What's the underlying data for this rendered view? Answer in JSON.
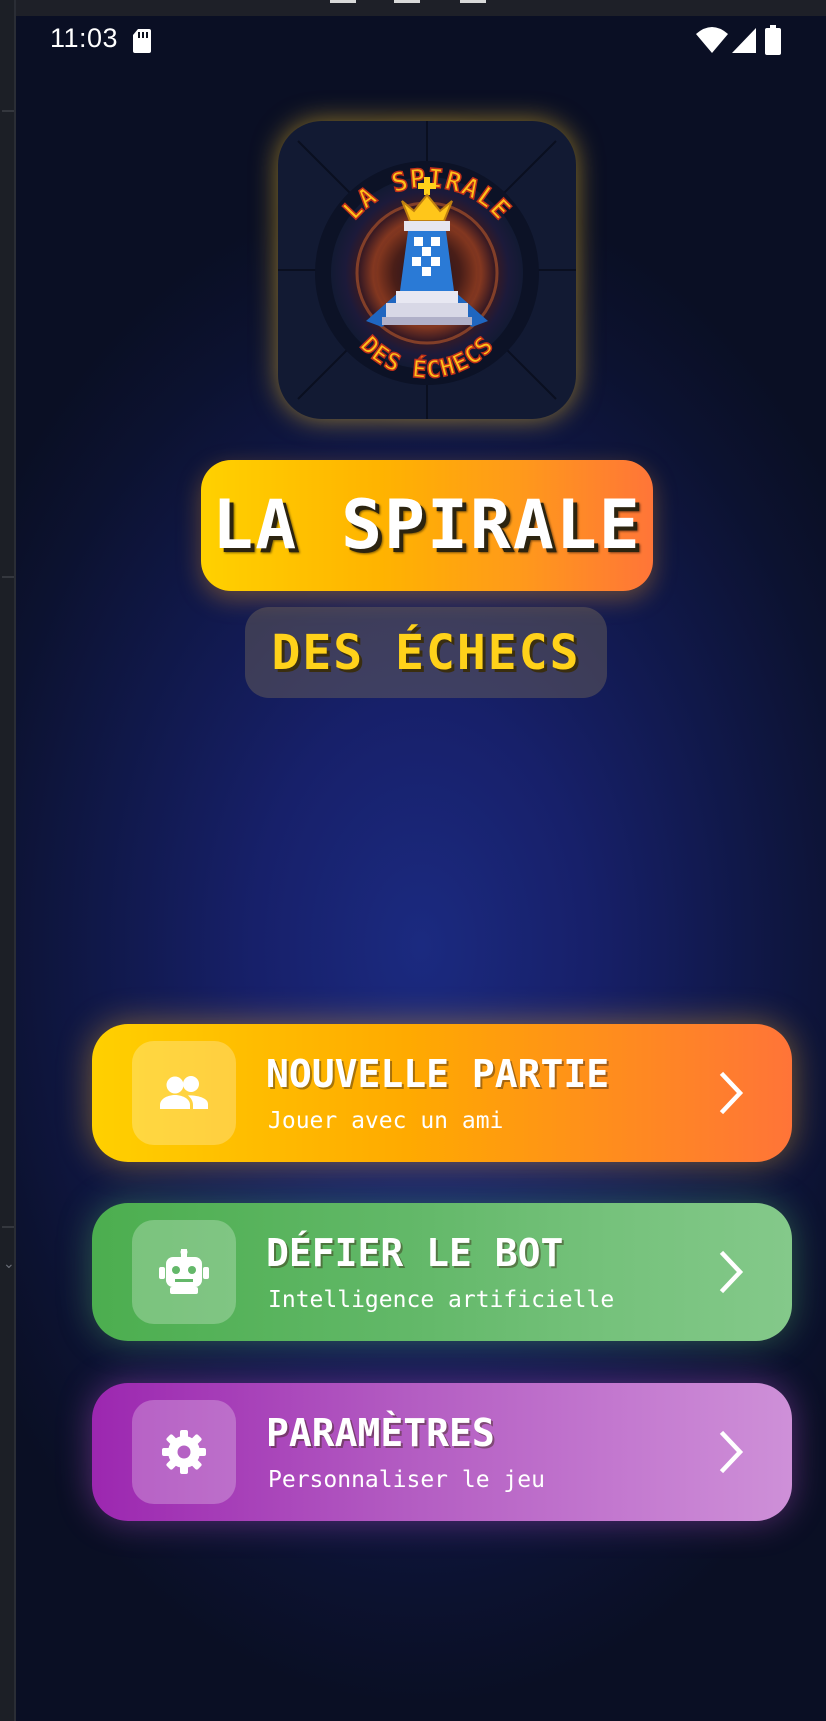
{
  "status_bar": {
    "time": "11:03",
    "icons": [
      "sd-card-icon",
      "wifi-icon",
      "signal-icon",
      "battery-icon"
    ]
  },
  "logo": {
    "line1": "LA SPIRALE",
    "line2": "DES ÉCHECS",
    "icon": "king-chess-piece-icon"
  },
  "title": {
    "main": "LA SPIRALE",
    "sub": "DES ÉCHECS"
  },
  "menu": [
    {
      "label": "NOUVELLE PARTIE",
      "subtitle": "Jouer avec un ami",
      "icon": "group-icon",
      "color_start": "#ffd000",
      "color_end": "#ff7438"
    },
    {
      "label": "DÉFIER LE BOT",
      "subtitle": "Intelligence artificielle",
      "icon": "robot-icon",
      "color_start": "#4cae4f",
      "color_end": "#84c98a"
    },
    {
      "label": "PARAMÈTRES",
      "subtitle": "Personnaliser le jeu",
      "icon": "gear-icon",
      "color_start": "#9c27b0",
      "color_end": "#ce90d8"
    }
  ],
  "colors": {
    "background": "#17206a",
    "title_gradient_start": "#ffd100",
    "title_gradient_end": "#ff7538",
    "subtitle_text": "#ffd21a"
  }
}
